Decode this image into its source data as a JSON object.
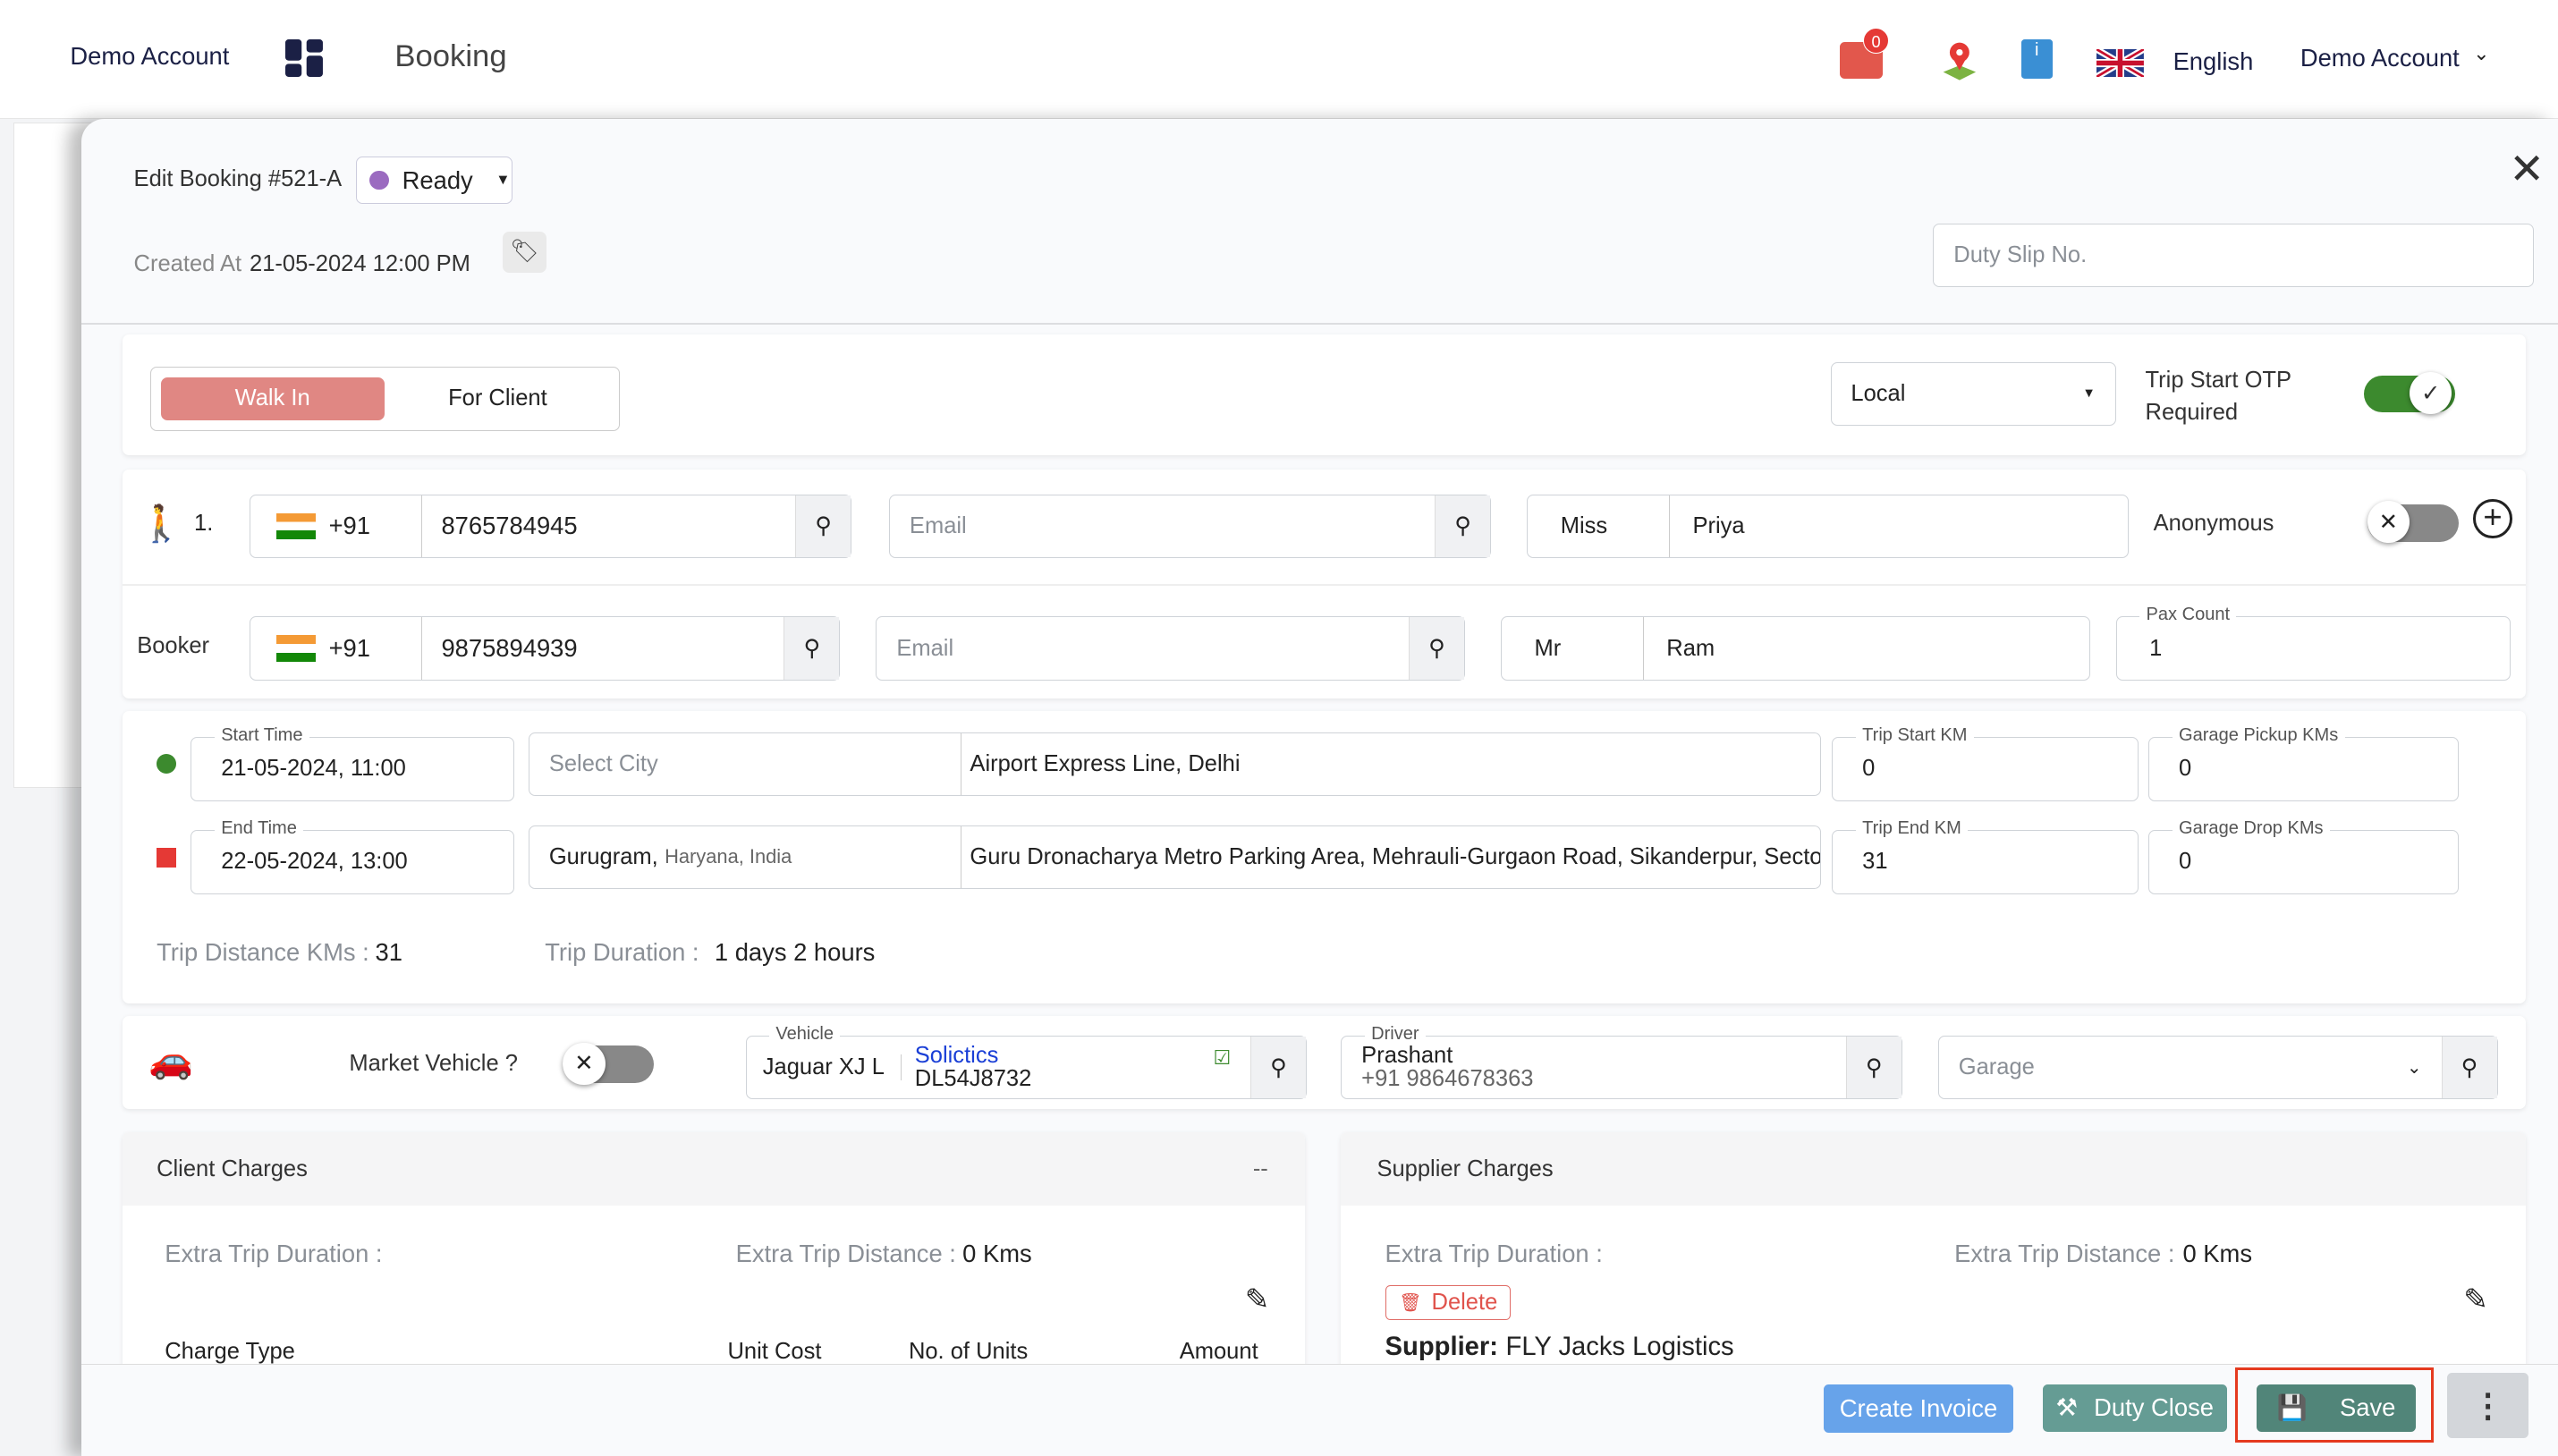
{
  "header": {
    "account": "Demo Account",
    "title": "Booking",
    "notification_count": "0",
    "language": "English",
    "user": "Demo Account"
  },
  "booking": {
    "title": "Edit Booking #521-A",
    "status": "Ready",
    "status_color": "#9b6bc0",
    "created_label": "Created At",
    "created_value": "21-05-2024 12:00 PM",
    "duty_slip_placeholder": "Duty Slip No."
  },
  "type_toggle": {
    "options": [
      "Walk In",
      "For Client"
    ],
    "selected": "Walk In"
  },
  "trip_type": "Local",
  "otp": {
    "label": "Trip Start OTP Required",
    "enabled": true
  },
  "passenger": {
    "index": "1.",
    "code": "+91",
    "phone": "8765784945",
    "email_placeholder": "Email",
    "title": "Miss",
    "name": "Priya",
    "anonymous_label": "Anonymous",
    "anonymous": false
  },
  "booker": {
    "label": "Booker",
    "code": "+91",
    "phone": "9875894939",
    "email_placeholder": "Email",
    "title": "Mr",
    "name": "Ram",
    "pax_label": "Pax Count",
    "pax": "1"
  },
  "trip": {
    "start_label": "Start Time",
    "start": "21-05-2024, 11:00",
    "start_city_placeholder": "Select City",
    "start_address": "Airport Express Line, Delhi",
    "end_label": "End Time",
    "end": "22-05-2024, 13:00",
    "end_city": "Gurugram,",
    "end_region": "Haryana, India",
    "end_address": "Guru Dronacharya Metro Parking Area, Mehrauli-Gurgaon Road, Sikanderpur, Sector",
    "start_km_label": "Trip Start KM",
    "start_km": "0",
    "end_km_label": "Trip End KM",
    "end_km": "31",
    "pickup_label": "Garage Pickup KMs",
    "pickup": "0",
    "drop_label": "Garage Drop KMs",
    "drop": "0",
    "distance_label": "Trip Distance KMs :",
    "distance": "31",
    "duration_label": "Trip Duration :",
    "duration": "1 days 2 hours"
  },
  "vehicle": {
    "market_label": "Market Vehicle ?",
    "market": false,
    "label": "Vehicle",
    "model": "Jaguar XJ L",
    "vendor": "Solictics",
    "plate": "DL54J8732",
    "driver_label": "Driver",
    "driver": "Prashant",
    "driver_phone": "+91 9864678363",
    "garage_placeholder": "Garage"
  },
  "client_charges": {
    "title": "Client Charges",
    "collapse": "--",
    "extra_duration_label": "Extra Trip Duration :",
    "extra_distance_label": "Extra Trip Distance :",
    "extra_distance": "0 Kms",
    "columns": [
      "Charge Type",
      "Unit Cost",
      "No. of Units",
      "Amount"
    ]
  },
  "supplier_charges": {
    "title": "Supplier Charges",
    "extra_duration_label": "Extra Trip Duration :",
    "extra_distance_label": "Extra Trip Distance :",
    "extra_distance": "0 Kms",
    "delete_label": "Delete",
    "supplier_label": "Supplier:",
    "supplier": "FLY Jacks Logistics"
  },
  "footer": {
    "create_invoice": "Create Invoice",
    "duty_close": "Duty Close",
    "save": "Save"
  },
  "colors": {
    "walkin": "#e08783",
    "switch_on": "#3c8a2e",
    "start_dot": "#3c8a2e",
    "end_dot": "#e53935",
    "create_invoice": "#67a3ea",
    "duty_close": "#659c94",
    "save": "#518579",
    "highlight": "#e53a1f"
  }
}
